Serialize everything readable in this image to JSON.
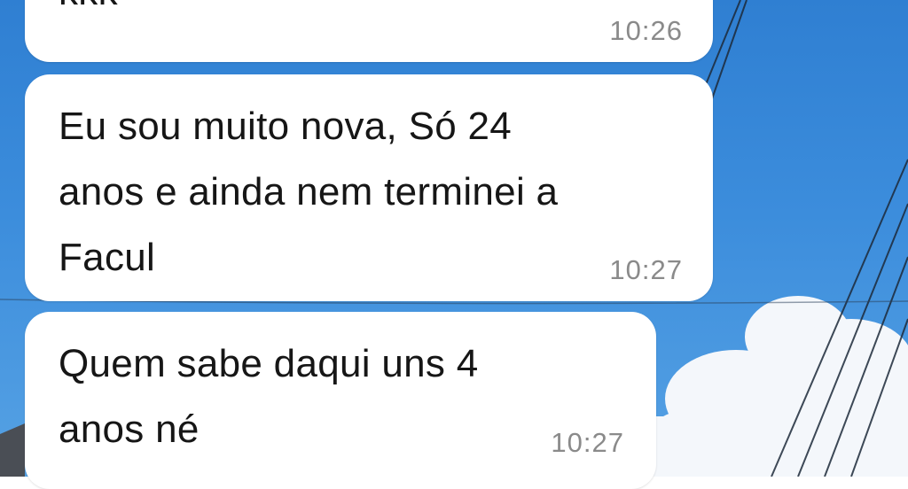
{
  "chat": {
    "messages": [
      {
        "text": "kkk",
        "time": "10:26"
      },
      {
        "text": "Eu sou muito nova, Só 24\nanos e ainda nem terminei a\nFacul",
        "time": "10:27"
      },
      {
        "text": "Quem sabe daqui uns 4\nanos né",
        "time": "10:27"
      }
    ]
  },
  "theme": {
    "bubble_color": "#ffffff",
    "text_color": "#161616",
    "timestamp_color": "#8a8a8a",
    "sky_color": "#3c8ddc"
  }
}
